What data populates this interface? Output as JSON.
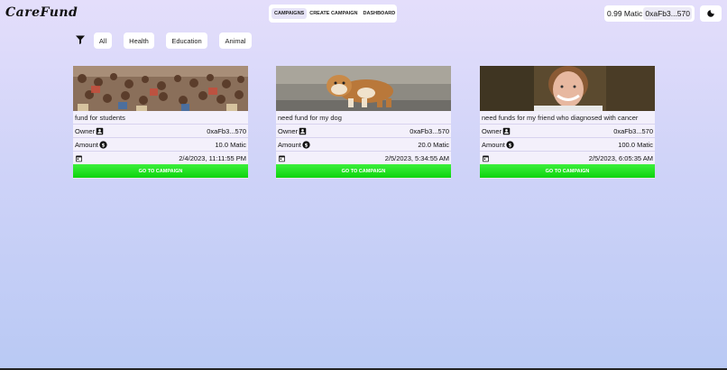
{
  "app": {
    "logo": "CareFund"
  },
  "nav": {
    "items": [
      "CAMPAIGNS",
      "CREATE CAMPAIGN",
      "DASHBOARD"
    ]
  },
  "wallet": {
    "balance": "0.99 Matic",
    "address": "0xaFb3...570"
  },
  "filters": [
    "All",
    "Health",
    "Education",
    "Animal"
  ],
  "card_labels": {
    "owner": "Owner",
    "amount": "Amount",
    "button": "GO TO CAMPAIGN"
  },
  "campaigns": [
    {
      "title": "fund for students",
      "owner": "0xaFb3...570",
      "amount": "10.0 Matic",
      "date": "2/4/2023, 11:11:55 PM"
    },
    {
      "title": "need fund for my dog",
      "owner": "0xaFb3...570",
      "amount": "20.0 Matic",
      "date": "2/5/2023, 5:34:55 AM"
    },
    {
      "title": "need funds for my friend who diagnosed with cancer",
      "owner": "0xaFb3...570",
      "amount": "100.0 Matic",
      "date": "2/5/2023, 6:05:35 AM"
    }
  ],
  "colors": {
    "accent_green": "#0dd30d",
    "background_top": "#e4defb",
    "background_bottom": "#b9c9f4"
  },
  "icons": {
    "filter": "filter-icon",
    "owner": "person-badge-icon",
    "amount": "dollar-circle-icon",
    "date": "calendar-icon",
    "theme": "moon-icon"
  }
}
